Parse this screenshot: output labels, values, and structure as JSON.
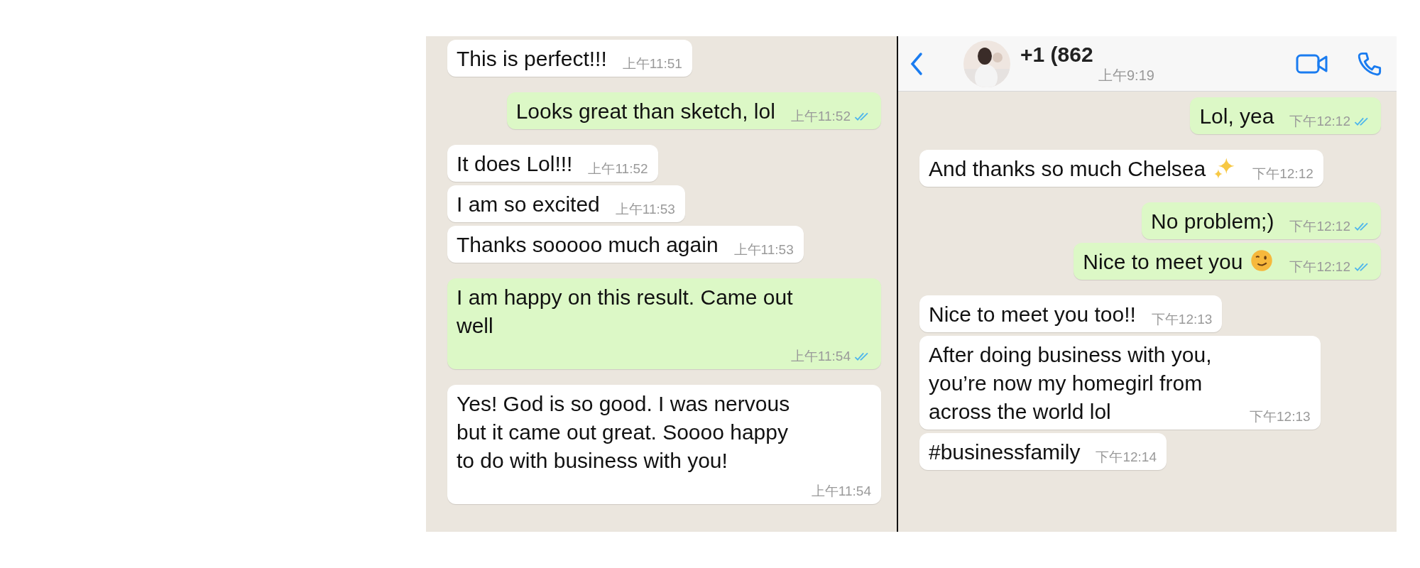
{
  "left_chat": {
    "messages": [
      {
        "outgoing": false,
        "text": "This is perfect!!!",
        "time": "上午11:51"
      },
      {
        "outgoing": true,
        "text": "Looks great than sketch, lol",
        "time": "上午11:52",
        "read": true
      },
      {
        "outgoing": false,
        "text": "It does Lol!!!",
        "time": "上午11:52"
      },
      {
        "outgoing": false,
        "text": "I am so excited",
        "time": "上午11:53"
      },
      {
        "outgoing": false,
        "text": "Thanks sooooo much again",
        "time": "上午11:53"
      },
      {
        "outgoing": true,
        "text": "I am happy on this result. Came out well",
        "time": "上午11:54",
        "read": true
      },
      {
        "outgoing": false,
        "text": "Yes! God is so good. I was nervous but it came out great. Soooo happy to do with business with you!",
        "time": "上午11:54"
      }
    ]
  },
  "right_chat": {
    "header": {
      "contact": "+1 (862",
      "status": "上午9:19"
    },
    "messages": [
      {
        "outgoing": true,
        "text": "Lol, yea",
        "time": "下午12:12",
        "read": true
      },
      {
        "outgoing": false,
        "text": "And thanks so much Chelsea",
        "kind": "sparkles",
        "time": "下午12:12"
      },
      {
        "outgoing": true,
        "text": "No problem;)",
        "time": "下午12:12",
        "read": true
      },
      {
        "outgoing": true,
        "text": "Nice to meet you",
        "kind": "wink",
        "time": "下午12:12",
        "read": true
      },
      {
        "outgoing": false,
        "text": "Nice to meet you too!!",
        "time": "下午12:13"
      },
      {
        "outgoing": false,
        "text": "After doing business with you, you’re now my homegirl from across the world lol",
        "time": "下午12:13"
      },
      {
        "outgoing": false,
        "text": "#businessfamily",
        "time": "下午12:14"
      }
    ]
  }
}
